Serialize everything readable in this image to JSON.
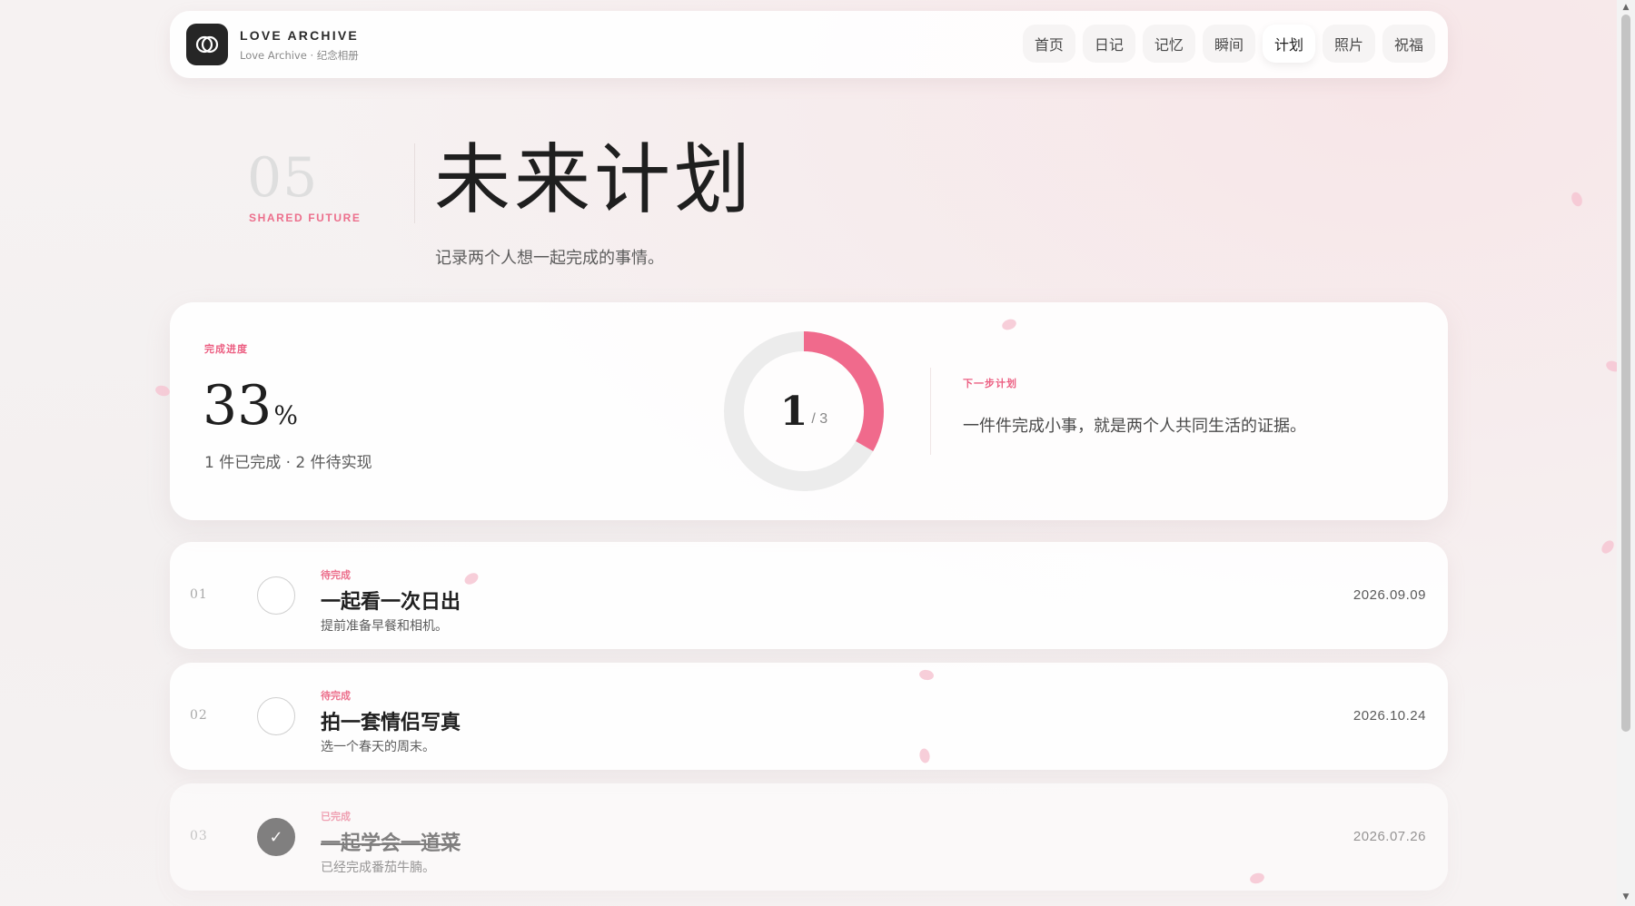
{
  "header": {
    "brand_title": "LOVE ARCHIVE",
    "brand_subtitle": "Love Archive · 纪念相册",
    "logo_icon": "interlocking-rings-icon",
    "nav": [
      {
        "label": "首页",
        "active": false
      },
      {
        "label": "日记",
        "active": false
      },
      {
        "label": "记忆",
        "active": false
      },
      {
        "label": "瞬间",
        "active": false
      },
      {
        "label": "计划",
        "active": true
      },
      {
        "label": "照片",
        "active": false
      },
      {
        "label": "祝福",
        "active": false
      }
    ]
  },
  "hero": {
    "number": "05",
    "tag": "SHARED FUTURE",
    "title": "未来计划",
    "subtitle": "记录两个人想一起完成的事情。"
  },
  "progress": {
    "label": "完成进度",
    "percent": "33",
    "percent_unit": "%",
    "detail": "1 件已完成 · 2 件待实现",
    "ring_done": "1",
    "ring_total": "/ 3",
    "ring_fraction": 0.3333,
    "accent_color": "#f06a8c",
    "track_color": "#ececec",
    "next_label": "下一步计划",
    "next_text": "一件件完成小事，就是两个人共同生活的证据。"
  },
  "plans": [
    {
      "index": "01",
      "status": "待完成",
      "title": "一起看一次日出",
      "desc": "提前准备早餐和相机。",
      "date": "2026.09.09",
      "done": false
    },
    {
      "index": "02",
      "status": "待完成",
      "title": "拍一套情侣写真",
      "desc": "选一个春天的周末。",
      "date": "2026.10.24",
      "done": false
    },
    {
      "index": "03",
      "status": "已完成",
      "title": "一起学会一道菜",
      "desc": "已经完成番茄牛腩。",
      "date": "2026.07.26",
      "done": true,
      "check_glyph": "✓"
    }
  ]
}
